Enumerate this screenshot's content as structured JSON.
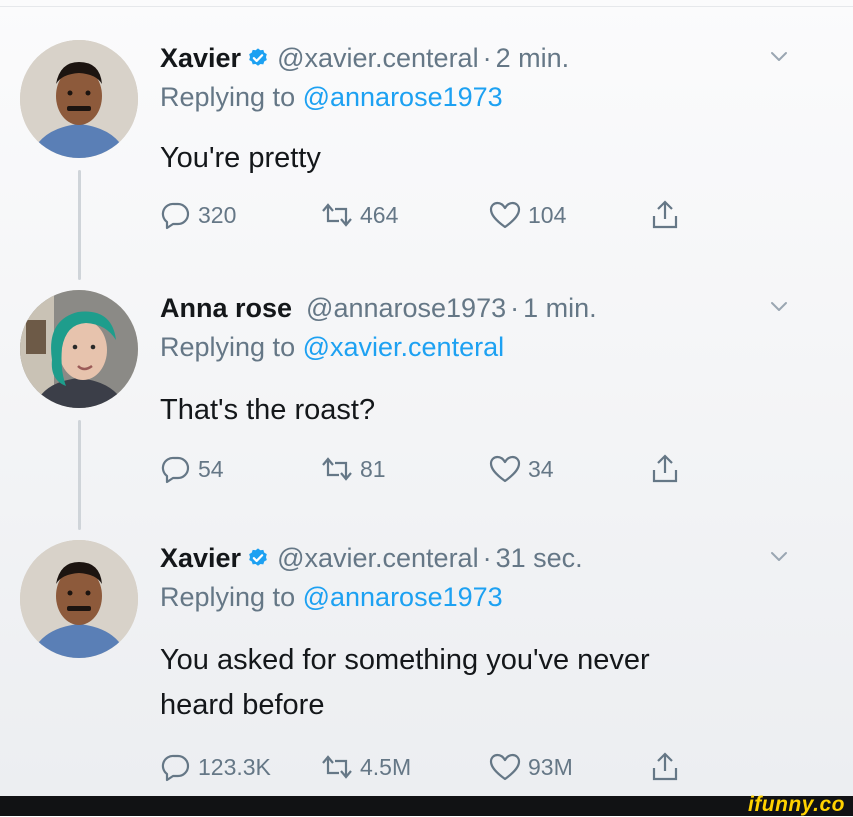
{
  "tweets": [
    {
      "name": "Xavier",
      "verified": true,
      "handle": "@xavier.centeral",
      "dot": "·",
      "time": "2 min.",
      "reply_prefix": "Replying to ",
      "reply_handle": "@annarose1973",
      "body": [
        "You're pretty"
      ],
      "replies": "320",
      "retweets": "464",
      "likes": "104"
    },
    {
      "name": "Anna rose",
      "verified": false,
      "handle": "@annarose1973",
      "dot": "·",
      "time": "1 min.",
      "reply_prefix": "Replying to ",
      "reply_handle": "@xavier.centeral",
      "body": [
        "That's the roast?"
      ],
      "replies": "54",
      "retweets": "81",
      "likes": "34"
    },
    {
      "name": "Xavier",
      "verified": true,
      "handle": "@xavier.centeral",
      "dot": "·",
      "time": "31 sec.",
      "reply_prefix": "Replying to ",
      "reply_handle": "@annarose1973",
      "body": [
        "You asked for something you've never",
        "heard before"
      ],
      "replies": "123.3K",
      "retweets": "4.5M",
      "likes": "93M"
    }
  ],
  "watermark": "ifunny.co",
  "icons": {
    "verified": "verified-badge-icon",
    "reply": "reply-bubble-icon",
    "retweet": "retweet-icon",
    "like": "heart-icon",
    "share": "share-icon",
    "more": "chevron-down-icon"
  },
  "colors": {
    "link": "#1da1f2",
    "muted": "#657786",
    "text": "#14171a",
    "verified": "#1da1f2"
  }
}
